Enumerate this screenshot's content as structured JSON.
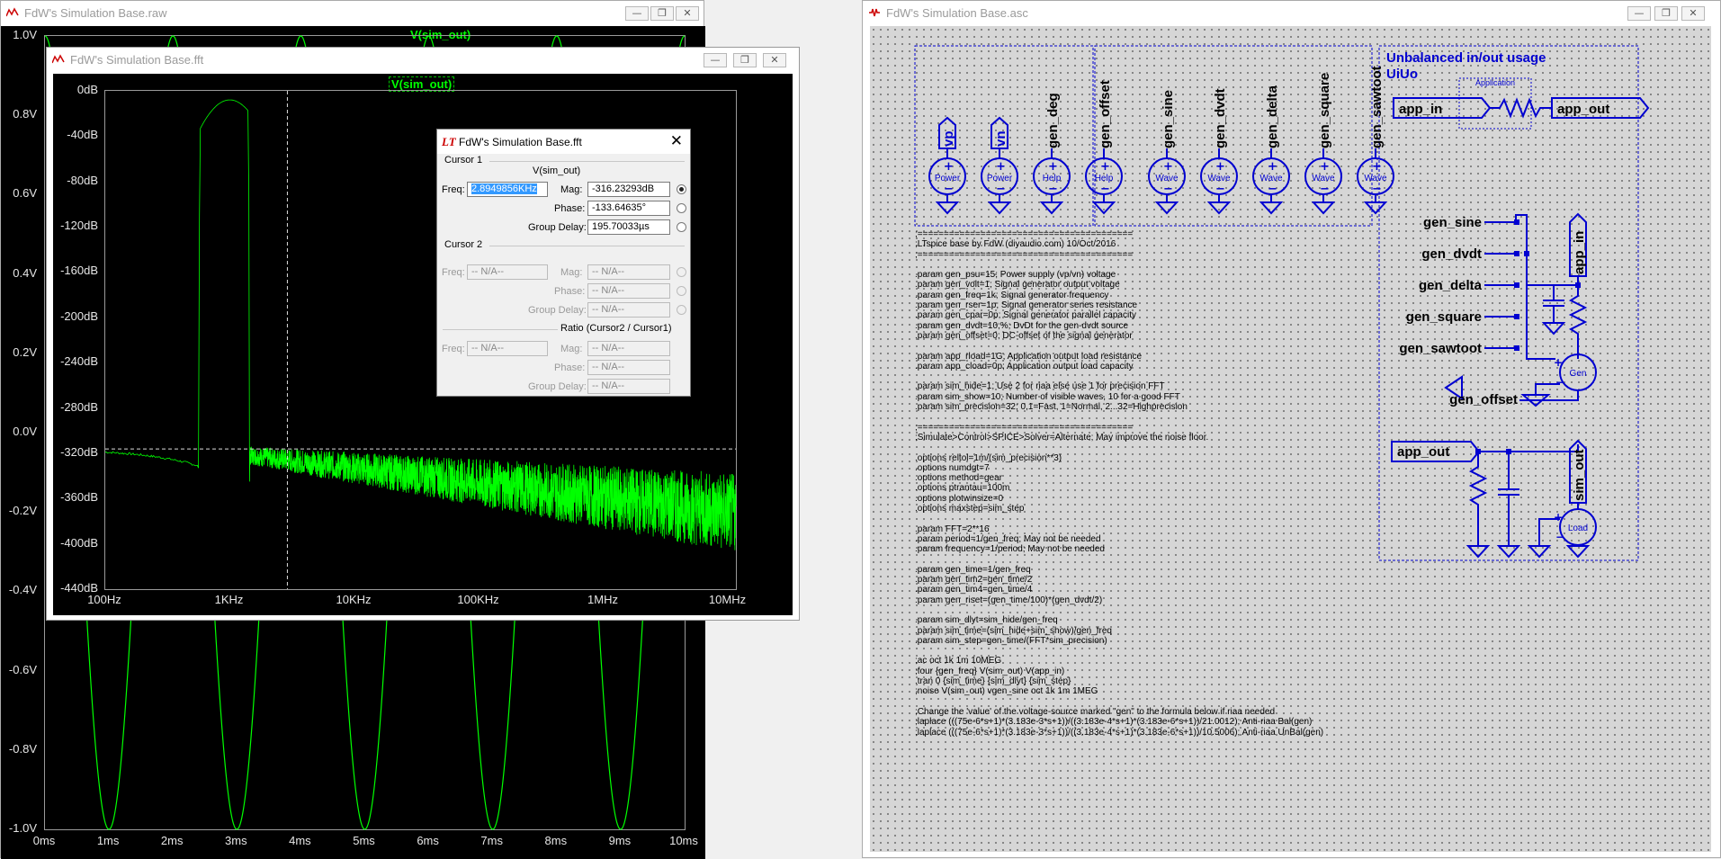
{
  "raw_window": {
    "title": "FdW's Simulation Base.raw",
    "trace_label": "V(sim_out)",
    "y_ticks": [
      "1.0V",
      "0.8V",
      "0.6V",
      "0.4V",
      "0.2V",
      "0.0V",
      "-0.2V",
      "-0.4V",
      "-0.6V",
      "-0.8V",
      "-1.0V"
    ],
    "x_ticks": [
      "0ms",
      "1ms",
      "2ms",
      "3ms",
      "4ms",
      "5ms",
      "6ms",
      "7ms",
      "8ms",
      "9ms",
      "10ms"
    ],
    "trace_color": "#00ff00"
  },
  "fft_window": {
    "title": "FdW's Simulation Base.fft",
    "trace_label": "V(sim_out)",
    "y_ticks": [
      "0dB",
      "-40dB",
      "-80dB",
      "-120dB",
      "-160dB",
      "-200dB",
      "-240dB",
      "-280dB",
      "-320dB",
      "-360dB",
      "-400dB",
      "-440dB"
    ],
    "x_ticks": [
      "100Hz",
      "1KHz",
      "10KHz",
      "100KHz",
      "1MHz",
      "10MHz"
    ]
  },
  "cursor_dialog": {
    "title": "FdW's Simulation Base.fft",
    "cursor1": {
      "group_label": "Cursor 1",
      "trace": "V(sim_out)",
      "freq_label": "Freq:",
      "freq_value": "2.8949856KHz",
      "mag_label": "Mag:",
      "mag_value": "-316.23293dB",
      "phase_label": "Phase:",
      "phase_value": "-133.64635°",
      "gd_label": "Group Delay:",
      "gd_value": "195.70033µs"
    },
    "cursor2": {
      "group_label": "Cursor 2",
      "freq_label": "Freq:",
      "freq_value": "-- N/A--",
      "mag_label": "Mag:",
      "mag_value": "-- N/A--",
      "phase_label": "Phase:",
      "phase_value": "-- N/A--",
      "gd_label": "Group Delay:",
      "gd_value": "-- N/A--"
    },
    "ratio": {
      "group_label": "Ratio (Cursor2 / Cursor1)",
      "freq_label": "Freq:",
      "freq_value": "-- N/A--",
      "mag_label": "Mag:",
      "mag_value": "-- N/A--",
      "phase_label": "Phase:",
      "phase_value": "-- N/A--",
      "gd_label": "Group Delay:",
      "gd_value": "-- N/A--"
    }
  },
  "asc_window": {
    "title": "FdW's Simulation Base.asc",
    "sources": [
      {
        "net": "vp",
        "sym": "Power"
      },
      {
        "net": "vn",
        "sym": "Power"
      },
      {
        "net": "gen_deg",
        "sym": "Help"
      },
      {
        "net": "gen_offset",
        "sym": "Help"
      },
      {
        "net": "gen_sine",
        "sym": "Wave"
      },
      {
        "net": "gen_dvdt",
        "sym": "Wave"
      },
      {
        "net": "gen_delta",
        "sym": "Wave"
      },
      {
        "net": "gen_square",
        "sym": "Wave"
      },
      {
        "net": "gen_sawtoot",
        "sym": "Wave"
      }
    ],
    "right_block": {
      "heading1": "Unbalanced in/out usage",
      "heading2": "UiUo",
      "app_box_label": "Application",
      "app_in": "app_in",
      "app_out": "app_out",
      "gen_nets": [
        "gen_sine",
        "gen_dvdt",
        "gen_delta",
        "gen_square",
        "gen_sawtoot"
      ],
      "gen_offset": "gen_offset",
      "app_in_vertical": "app_in",
      "gen_label": "Gen",
      "app_out2": "app_out",
      "sim_out": "sim_out",
      "load_label": "Load"
    },
    "spice_lines": [
      ";=========================================",
      ";LTspice base by FdW (diyaudio.com) 10/Oct/2016",
      ";=========================================",
      "",
      ".param gen_psu=15; Power supply (vp/vn) voltage",
      ".param gen_volt=1; Signal generator output voltage",
      ".param gen_freq=1k; Signal generator frequency",
      ".param gen_rser=1p; Signal generator series resistance",
      ".param gen_cpar=0p; Signal generator parallel capacity",
      ".param gen_dvdt=10;%; DvDt for the gen-dvdt source",
      ".param gen_offset=0; DC-offset of the signal generator",
      "",
      ".param app_rload=1G; Application output load resistance",
      ".param app_cload=0p; Application output load capacity",
      "",
      ".param sim_hide=1; Use 2 for riaa else use 1 for precision FFT",
      ".param sim_show=10; Number of visible waves, 10 for a good FFT",
      ".param sim_precision=32; 0,1=Fast, 1=Normal, 2...32=Highprecision",
      "",
      ";=========================================",
      ";Simulate>Control>SPICE>Solver=Alternate; May improve the noise floor.",
      "",
      ".options reltol=1m/(sim_precision**3)",
      ".options numdgt=7",
      ".options method=gear",
      ".options ptrantau=100m",
      ".options plotwinsize=0",
      ".options maxstep=sim_step",
      "",
      ".param FFT=2**16",
      ".param period=1/gen_freq; May not be needed",
      ".param frequency=1/period; May not be needed",
      "",
      ".param gen_time=1/gen_freq",
      ".param gen_tim2=gen_time/2",
      ".param gen_tim4=gen_time/4",
      ".param gen_riset=(gen_time/100)*(gen_dvdt/2)",
      "",
      ".param sim_dlyt=sim_hide/gen_freq",
      ".param sim_time=(sim_hide+sim_show)/gen_freq",
      ".param sim_step=gen_time/(FFT*sim_precision)",
      "",
      ";ac oct 1k 1m 10MEG",
      ";four {gen_freq} V(sim_out) V(app_in)",
      ".tran 0 {sim_time} {sim_dlyt} {sim_step}",
      ";noise V(sim_out) vgen_sine oct 1k 1m 1MEG",
      "",
      ";Change the 'value' of the voltage-source marked \"gen\" to the formula below if riaa needed",
      ";laplace (((75e-6*s+1)*(3.183e-3*s+1))/((3.183e-4*s+1)*(3.183e-6*s+1))/21.0012); Anti-riaa Bal(gen)",
      ";laplace (((75e-6*s+1)*(3.183e-3*s+1))/((3.183e-4*s+1)*(3.183e-6*s+1))/10.5006); Anti-riaa UnBal(gen)"
    ],
    "schematic_color": "#0000d0"
  }
}
